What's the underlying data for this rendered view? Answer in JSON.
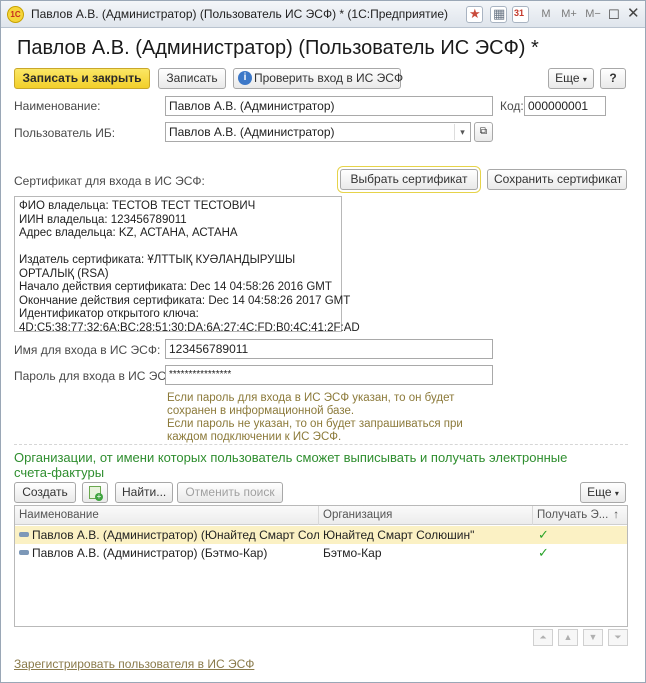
{
  "titlebar": {
    "app_icon": "1C",
    "title": "Павлов А.В. (Администратор) (Пользователь ИС ЭСФ) * (1С:Предприятие)",
    "m": "M",
    "m_plus": "M+",
    "m_minus": "M−"
  },
  "page_title": "Павлов А.В. (Администратор) (Пользователь ИС ЭСФ) *",
  "toolbar": {
    "save_close": "Записать и закрыть",
    "save": "Записать",
    "check_login": "Проверить вход в ИС ЭСФ",
    "more": "Еще",
    "help": "?"
  },
  "form": {
    "name_label": "Наименование:",
    "name_value": "Павлов А.В. (Администратор)",
    "code_label": "Код:",
    "code_value": "000000001",
    "ib_user_label": "Пользователь ИБ:",
    "ib_user_value": "Павлов А.В. (Администратор)",
    "cert_label": "Сертификат для входа в ИС ЭСФ:",
    "select_cert": "Выбрать сертификат",
    "save_cert": "Сохранить сертификат",
    "cert_info": [
      "ФИО владельца: ТЕСТОВ ТЕСТ ТЕСТОВИЧ",
      "ИИН владельца: 123456789011",
      "Адрес владельца: KZ, АСТАНА, АСТАНА",
      "",
      "Издатель сертификата: ҰЛТТЫҚ КУӘЛАНДЫРУШЫ",
      "ОРТАЛЫҚ (RSA)",
      "Начало действия сертификата: Dec 14 04:58:26 2016 GMT",
      "Окончание действия сертификата: Dec 14 04:58:26 2017 GMT",
      "Идентификатор открытого ключа:",
      "4D:C5:38:77:32:6A:BC:28:51:30:DA:6A:27:4C:FD:B0:4C:41:2F:AD"
    ],
    "login_label": "Имя для входа в ИС ЭСФ:",
    "login_value": "123456789011",
    "password_label": "Пароль для входа в ИС ЭСФ:",
    "password_value": "****************",
    "hint": [
      "Если пароль для входа в ИС ЭСФ указан, то он будет",
      "сохранен в информационной базе.",
      "Если пароль не указан, то он будет запрашиваться при",
      "каждом подключении к ИС ЭСФ."
    ]
  },
  "orgs": {
    "title_line1": "Организации, от имени которых пользователь сможет выписывать и получать электронные",
    "title_line2": "счета-фактуры",
    "create": "Создать",
    "find": "Найти...",
    "cancel_search": "Отменить поиск",
    "more": "Еще",
    "columns": [
      "Наименование",
      "Организация",
      "Получать Э..."
    ],
    "rows": [
      {
        "name": "Павлов А.В. (Администратор) (Юнайтед Смарт Солю...",
        "org": "Юнайтед Смарт Солюшин\"",
        "receive": "✓"
      },
      {
        "name": "Павлов А.В. (Администратор) (Бэтмо-Кар)",
        "org": "Бэтмо-Кар",
        "receive": "✓"
      }
    ]
  },
  "register_link": "Зарегистрировать пользователя в ИС ЭСФ"
}
